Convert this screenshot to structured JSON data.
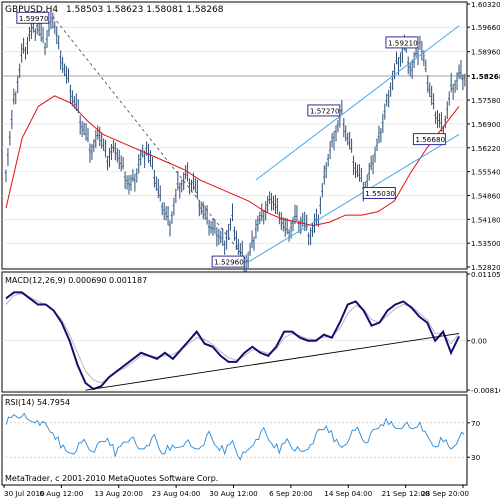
{
  "window": {
    "symbol_header": "GBPUSD,H4",
    "ohlc": "1.58503 1.58623 1.58081 1.58268",
    "footer": "MetaTrader, c 2001-2010 MetaQuotes Software Corp."
  },
  "chart_data": [
    {
      "type": "line",
      "title": "GBPUSD,H4 1.58503 1.58623 1.58081 1.58268",
      "ylim": [
        1.5282,
        1.6032
      ],
      "yticks": [
        "1.60320",
        "1.59660",
        "1.58960",
        "1.58268",
        "1.57580",
        "1.56900",
        "1.56220",
        "1.55540",
        "1.54860",
        "1.54180",
        "1.53500",
        "1.52820"
      ],
      "x_tick_labels": [
        "30 Jul 2010",
        "6 Aug 12:00",
        "13 Aug 20:00",
        "23 Aug 04:00",
        "30 Aug 12:00",
        "6 Sep 20:00",
        "14 Sep 04:00",
        "21 Sep 12:00",
        "28 Sep 20:00"
      ],
      "last_price": 1.58268,
      "series": [
        {
          "values": [
            1.556,
            1.575,
            1.588,
            1.594,
            1.597,
            1.591,
            1.5997,
            1.589,
            1.581,
            1.574,
            1.567,
            1.561,
            1.566,
            1.559,
            1.563,
            1.556,
            1.551,
            1.557,
            1.562,
            1.554,
            1.546,
            1.541,
            1.551,
            1.554,
            1.552,
            1.545,
            1.54,
            1.538,
            1.5355,
            1.542,
            1.532,
            1.5296,
            1.539,
            1.543,
            1.548,
            1.544,
            1.538,
            1.542,
            1.541,
            1.537,
            1.542,
            1.557,
            1.566,
            1.572,
            1.563,
            1.555,
            1.5503,
            1.558,
            1.567,
            1.578,
            1.586,
            1.591,
            1.584,
            1.5921,
            1.581,
            1.572,
            1.568,
            1.579,
            1.5827
          ]
        },
        {
          "values": [
            1.545,
            1.565,
            1.574,
            1.577,
            1.575,
            1.57,
            1.566,
            1.564,
            1.562,
            1.56,
            1.558,
            1.556,
            1.553,
            1.551,
            1.549,
            1.547,
            1.544,
            1.542,
            1.541,
            1.54,
            1.541,
            1.543,
            1.543,
            1.544,
            1.547,
            1.555,
            1.562,
            1.568,
            1.574
          ]
        }
      ],
      "annotations": [
        {
          "text": "1.59970",
          "x": 6,
          "y": 1.5997
        },
        {
          "text": "1.52960",
          "x": 31,
          "y": 1.5296
        },
        {
          "text": "1.57270",
          "x": 43,
          "y": 1.5727
        },
        {
          "text": "1.55030",
          "x": 46,
          "y": 1.5503
        },
        {
          "text": "1.59210",
          "x": 53,
          "y": 1.5921
        },
        {
          "text": "1.56680",
          "x": 56,
          "y": 1.5668
        }
      ],
      "channel": {
        "lower": [
          {
            "x": 31,
            "y": 1.5296
          },
          {
            "x": 58,
            "y": 1.566
          }
        ],
        "upper": [
          {
            "x": 32,
            "y": 1.553
          },
          {
            "x": 58,
            "y": 1.597
          }
        ]
      },
      "trendline": [
        {
          "x": 6,
          "y": 1.5997
        },
        {
          "x": 31,
          "y": 1.5296
        }
      ]
    },
    {
      "type": "line",
      "title": "MACD(12,26,9) 0.000690 0.001187",
      "ylim": [
        -0.00816,
        0.01105
      ],
      "yticks": [
        "0.01105",
        "0.00",
        "-0.00816"
      ],
      "series": [
        {
          "values": [
            0.007,
            0.008,
            0.008,
            0.007,
            0.006,
            0.006,
            0.005,
            0.003,
            0.0,
            -0.004,
            -0.007,
            -0.008,
            -0.0075,
            -0.006,
            -0.005,
            -0.004,
            -0.003,
            -0.002,
            -0.0025,
            -0.003,
            -0.002,
            -0.003,
            -0.0015,
            0.0,
            0.0015,
            -0.0005,
            -0.001,
            -0.0025,
            -0.0035,
            -0.0035,
            -0.002,
            -0.001,
            -0.002,
            -0.0025,
            -0.001,
            0.0015,
            0.0015,
            0.0005,
            0.0,
            0.0,
            0.001,
            0.0005,
            0.003,
            0.006,
            0.0065,
            0.005,
            0.0025,
            0.003,
            0.005,
            0.006,
            0.0065,
            0.0055,
            0.004,
            0.003,
            0.0,
            0.0015,
            -0.002,
            0.0007
          ]
        },
        {
          "values": [
            0.006,
            0.0075,
            0.0078,
            0.0072,
            0.0065,
            0.006,
            0.005,
            0.0035,
            0.001,
            -0.002,
            -0.005,
            -0.0065,
            -0.007,
            -0.006,
            -0.005,
            -0.0045,
            -0.0035,
            -0.0025,
            -0.0025,
            -0.0027,
            -0.0025,
            -0.0023,
            -0.0015,
            -0.0005,
            0.0005,
            0.0002,
            -0.0006,
            -0.0018,
            -0.0028,
            -0.0032,
            -0.0025,
            -0.0015,
            -0.0017,
            -0.0021,
            -0.0014,
            0.0005,
            0.0012,
            0.0008,
            0.0003,
            0.0002,
            0.0006,
            0.0007,
            0.002,
            0.0045,
            0.0058,
            0.0052,
            0.0035,
            0.003,
            0.0042,
            0.0053,
            0.006,
            0.0057,
            0.0046,
            0.0035,
            0.0012,
            0.0013,
            -0.0005,
            0.0012
          ]
        }
      ]
    },
    {
      "type": "line",
      "title": "RSI(14) 54.7954",
      "ylim": [
        0,
        100
      ],
      "yticks": [
        "70",
        "30"
      ],
      "series": [
        {
          "values": [
            72,
            78,
            80,
            70,
            74,
            66,
            58,
            45,
            34,
            40,
            48,
            38,
            44,
            52,
            35,
            46,
            55,
            37,
            45,
            52,
            34,
            42,
            40,
            50,
            38,
            44,
            56,
            42,
            38,
            48,
            30,
            36,
            52,
            60,
            46,
            39,
            50,
            40,
            34,
            46,
            58,
            66,
            52,
            40,
            55,
            62,
            48,
            58,
            68,
            72,
            62,
            70,
            60,
            72,
            50,
            42,
            52,
            38,
            55
          ]
        }
      ]
    }
  ]
}
